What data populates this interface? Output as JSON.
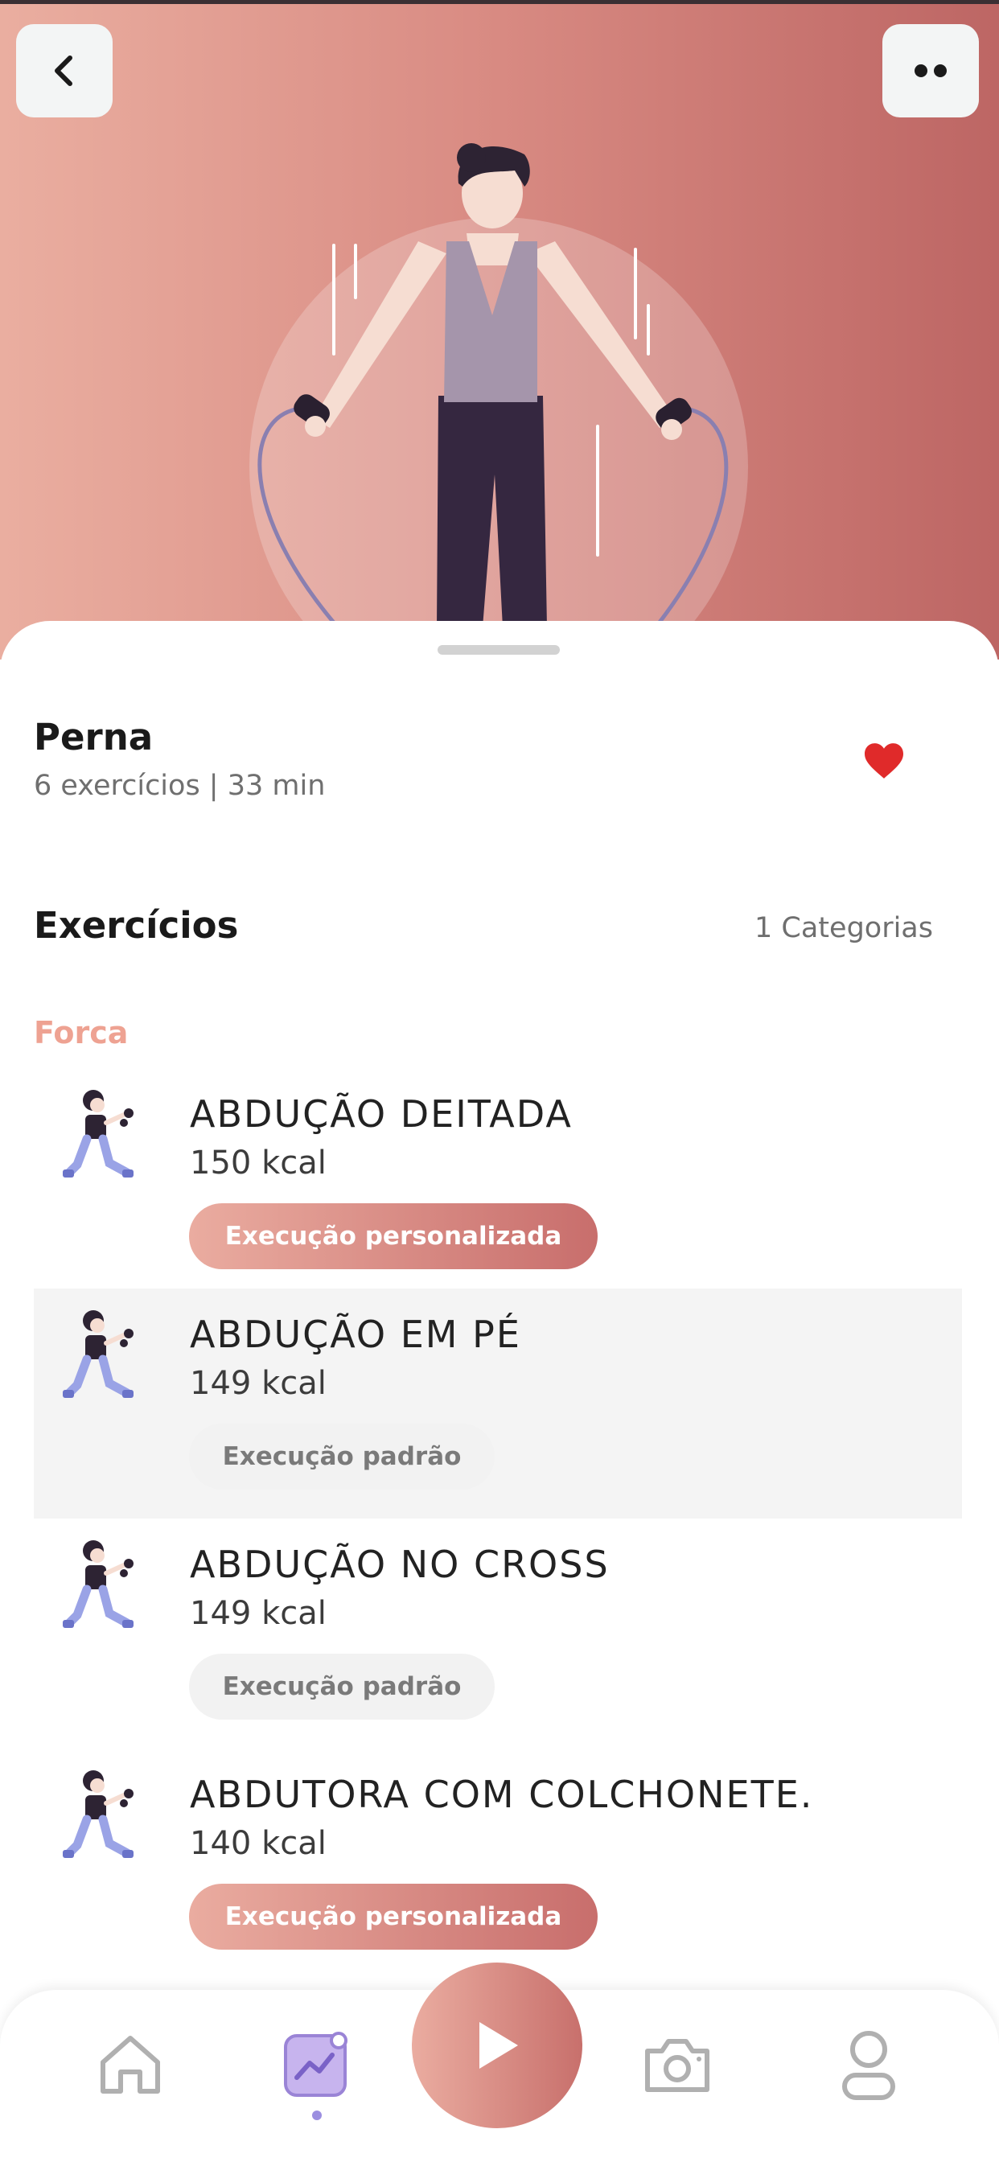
{
  "header": {
    "back_icon": "chevron-left-icon",
    "menu_icon": "two-dots-icon"
  },
  "workout": {
    "title": "Perna",
    "subtitle": "6 exercícios | 33 min",
    "favorite_icon": "heart-icon",
    "favorite_color": "#e02a2a"
  },
  "exercises_section": {
    "title": "Exercícios",
    "count_label": "1 Categorias"
  },
  "category": {
    "label": "Forca",
    "items": [
      {
        "name": "ABDUÇÃO DEITADA",
        "kcal": "150 kcal",
        "tag": "Execução personalizada",
        "tag_type": "custom"
      },
      {
        "name": "ABDUÇÃO EM PÉ",
        "kcal": "149 kcal",
        "tag": "Execução padrão",
        "tag_type": "default"
      },
      {
        "name": "ABDUÇÃO NO CROSS",
        "kcal": "149 kcal",
        "tag": "Execução padrão",
        "tag_type": "default"
      },
      {
        "name": "ABDUTORA COM COLCHONETE.",
        "kcal": "140 kcal",
        "tag": "Execução personalizada",
        "tag_type": "custom"
      }
    ]
  },
  "bottom_nav": {
    "items": [
      "home-icon",
      "chart-icon",
      "play-icon",
      "camera-icon",
      "profile-icon"
    ],
    "active_index": 1
  },
  "colors": {
    "accent_start": "#eaaca0",
    "accent_end": "#bd6664",
    "category_label": "#eea292",
    "nav_active": "#9b8ee0"
  }
}
